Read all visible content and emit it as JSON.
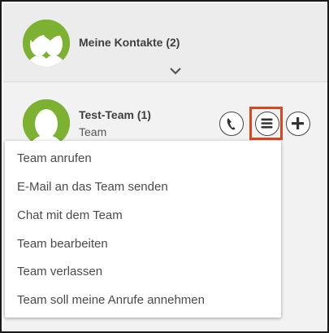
{
  "group": {
    "title": "Meine Kontakte (2)",
    "avatar_icon": "group-avatar-icon",
    "expand_icon": "chevron-down-icon"
  },
  "team": {
    "name": "Test-Team (1)",
    "subtitle": "Team",
    "avatar_icon": "team-avatar-icon",
    "actions": {
      "call_icon": "phone-icon",
      "menu_icon": "hamburger-menu-icon",
      "add_icon": "plus-icon"
    }
  },
  "context_menu": {
    "items": [
      {
        "label": "Team anrufen"
      },
      {
        "label": "E-Mail an das Team senden"
      },
      {
        "label": "Chat mit dem Team"
      },
      {
        "label": "Team bearbeiten"
      },
      {
        "label": "Team verlassen"
      },
      {
        "label": "Team soll meine Anrufe annehmen"
      }
    ]
  },
  "colors": {
    "avatar_green": "#7cb132",
    "highlight": "#e0441c",
    "text": "#4a4a4a",
    "panel_bg": "#f2f2f2"
  }
}
